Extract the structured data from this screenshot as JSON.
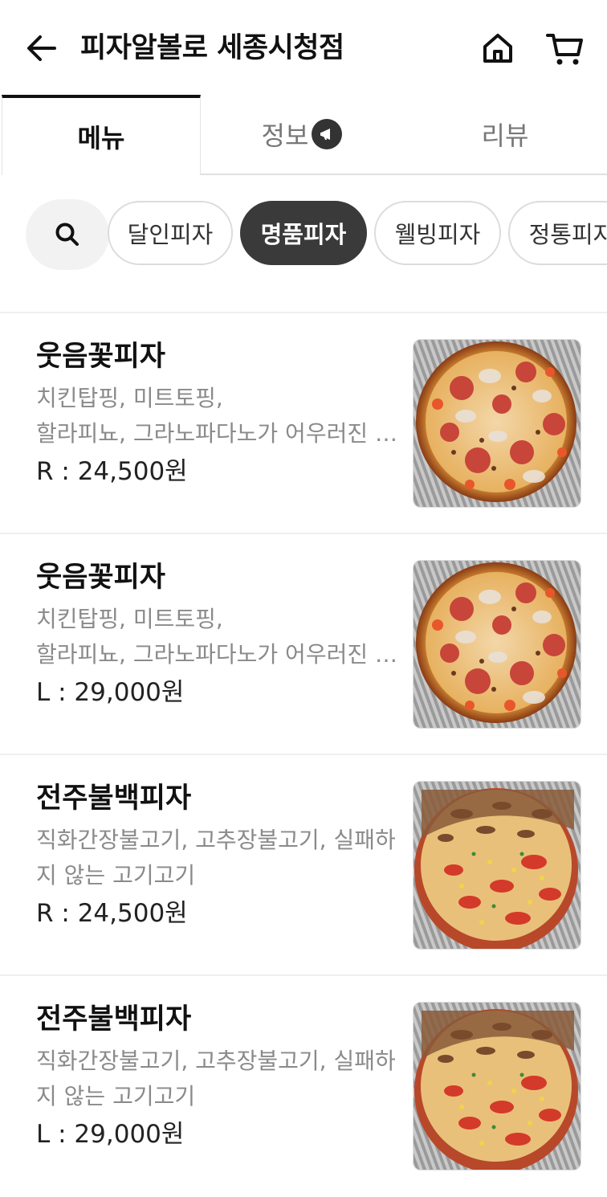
{
  "header": {
    "title": "피자알볼로 세종시청점"
  },
  "tabs": [
    {
      "label": "메뉴",
      "active": true
    },
    {
      "label": "정보",
      "active": false
    },
    {
      "label": "리뷰",
      "active": false
    }
  ],
  "categories": [
    {
      "label": "달인피자",
      "active": false
    },
    {
      "label": "명품피자",
      "active": true
    },
    {
      "label": "웰빙피자",
      "active": false
    },
    {
      "label": "정통피자",
      "active": false
    }
  ],
  "menu_items": [
    {
      "name": "웃음꽃피자",
      "desc_line1": "치킨탑핑, 미트토핑,",
      "desc_line2": "할라피뇨, 그라노파다노가 어우러진 피자",
      "price": "R : 24,500원",
      "image": "pepperoni-pizza"
    },
    {
      "name": "웃음꽃피자",
      "desc_line1": "치킨탑핑, 미트토핑,",
      "desc_line2": "할라피뇨, 그라노파다노가 어우러진 피자",
      "price": "L : 29,000원",
      "image": "pepperoni-pizza"
    },
    {
      "name": "전주불백피자",
      "desc_line1": "직화간장불고기, 고추장불고기, 실패하",
      "desc_line2": "지 않는 고기고기",
      "price": "R : 24,500원",
      "image": "bulgogi-pizza"
    },
    {
      "name": "전주불백피자",
      "desc_line1": "직화간장불고기, 고추장불고기, 실패하",
      "desc_line2": "지 않는 고기고기",
      "price": "L : 29,000원",
      "image": "bulgogi-pizza"
    }
  ],
  "colors": {
    "accent_dark": "#3a3a3a",
    "text_primary": "#111111",
    "text_secondary": "#8a8a8a"
  },
  "icons": [
    "back-arrow-icon",
    "home-icon",
    "cart-icon",
    "megaphone-icon",
    "search-icon"
  ]
}
